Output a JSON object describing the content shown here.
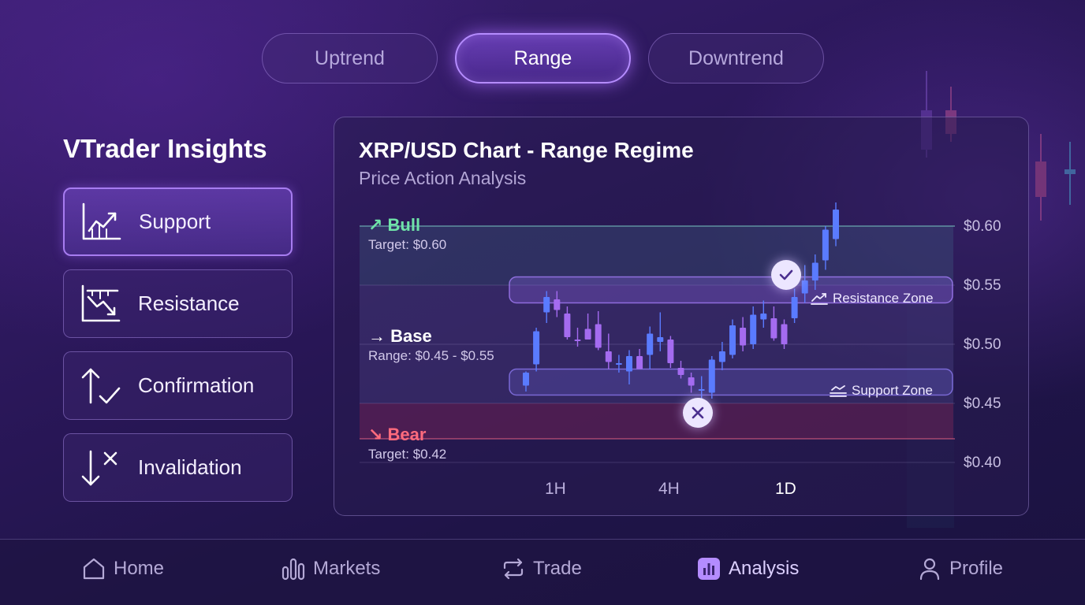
{
  "tabs": [
    {
      "label": "Uptrend",
      "active": false
    },
    {
      "label": "Range",
      "active": true
    },
    {
      "label": "Downtrend",
      "active": false
    }
  ],
  "sidebar": {
    "title": "VTrader Insights",
    "items": [
      {
        "label": "Support",
        "icon": "support-chart-icon",
        "active": true
      },
      {
        "label": "Resistance",
        "icon": "resistance-chart-icon",
        "active": false
      },
      {
        "label": "Confirmation",
        "icon": "confirmation-arrows-icon",
        "active": false
      },
      {
        "label": "Invalidation",
        "icon": "invalidation-arrow-icon",
        "active": false
      }
    ]
  },
  "chart": {
    "title": "XRP/USD Chart - Range Regime",
    "subtitle": "Price Action Analysis",
    "bull_label": "↗ Bull",
    "bull_target": "Target: $0.60",
    "base_label": "→ Base",
    "base_range": "Range: $0.45 - $0.55",
    "bear_label": "↘ Bear",
    "bear_target": "Target: $0.42",
    "resistance_zone": "Resistance Zone",
    "support_zone": "Support Zone",
    "price_ticks": [
      "$0.60",
      "$0.55",
      "$0.50",
      "$0.45",
      "$0.40"
    ],
    "timeframes": [
      {
        "label": "1H",
        "active": false
      },
      {
        "label": "4H",
        "active": false
      },
      {
        "label": "1D",
        "active": true
      }
    ],
    "colors": {
      "bull": "#6fe3a8",
      "bear": "#ff6b7d",
      "accent": "#a77cf0"
    }
  },
  "chart_data": {
    "type": "candlestick",
    "title": "XRP/USD Chart - Range Regime",
    "subtitle": "Price Action Analysis",
    "ylim": [
      0.4,
      0.6
    ],
    "y_ticks": [
      0.6,
      0.55,
      0.5,
      0.45,
      0.4
    ],
    "x_ticks": [
      "1H",
      "4H",
      "1D"
    ],
    "zones": {
      "bull_target": 0.6,
      "resistance": [
        0.535,
        0.557
      ],
      "support": [
        0.457,
        0.479
      ],
      "bear_target": 0.42
    },
    "candles": [
      {
        "o": 0.465,
        "h": 0.477,
        "l": 0.46,
        "c": 0.476
      },
      {
        "o": 0.483,
        "h": 0.514,
        "l": 0.477,
        "c": 0.511
      },
      {
        "o": 0.527,
        "h": 0.545,
        "l": 0.518,
        "c": 0.54
      },
      {
        "o": 0.538,
        "h": 0.545,
        "l": 0.523,
        "c": 0.529
      },
      {
        "o": 0.526,
        "h": 0.532,
        "l": 0.504,
        "c": 0.506
      },
      {
        "o": 0.504,
        "h": 0.514,
        "l": 0.498,
        "c": 0.503
      },
      {
        "o": 0.513,
        "h": 0.526,
        "l": 0.504,
        "c": 0.504
      },
      {
        "o": 0.517,
        "h": 0.528,
        "l": 0.495,
        "c": 0.497
      },
      {
        "o": 0.494,
        "h": 0.509,
        "l": 0.479,
        "c": 0.485
      },
      {
        "o": 0.484,
        "h": 0.491,
        "l": 0.476,
        "c": 0.484
      },
      {
        "o": 0.477,
        "h": 0.495,
        "l": 0.466,
        "c": 0.49
      },
      {
        "o": 0.49,
        "h": 0.496,
        "l": 0.479,
        "c": 0.479
      },
      {
        "o": 0.491,
        "h": 0.515,
        "l": 0.479,
        "c": 0.509
      },
      {
        "o": 0.502,
        "h": 0.527,
        "l": 0.494,
        "c": 0.506
      },
      {
        "o": 0.504,
        "h": 0.507,
        "l": 0.48,
        "c": 0.484
      },
      {
        "o": 0.48,
        "h": 0.486,
        "l": 0.471,
        "c": 0.474
      },
      {
        "o": 0.472,
        "h": 0.476,
        "l": 0.459,
        "c": 0.465
      },
      {
        "o": 0.462,
        "h": 0.473,
        "l": 0.451,
        "c": 0.462
      },
      {
        "o": 0.459,
        "h": 0.49,
        "l": 0.454,
        "c": 0.487
      },
      {
        "o": 0.485,
        "h": 0.502,
        "l": 0.478,
        "c": 0.494
      },
      {
        "o": 0.491,
        "h": 0.521,
        "l": 0.488,
        "c": 0.516
      },
      {
        "o": 0.514,
        "h": 0.523,
        "l": 0.494,
        "c": 0.499
      },
      {
        "o": 0.5,
        "h": 0.532,
        "l": 0.496,
        "c": 0.525
      },
      {
        "o": 0.521,
        "h": 0.537,
        "l": 0.514,
        "c": 0.526
      },
      {
        "o": 0.522,
        "h": 0.532,
        "l": 0.503,
        "c": 0.505
      },
      {
        "o": 0.517,
        "h": 0.521,
        "l": 0.496,
        "c": 0.5
      },
      {
        "o": 0.522,
        "h": 0.547,
        "l": 0.518,
        "c": 0.54
      },
      {
        "o": 0.543,
        "h": 0.567,
        "l": 0.535,
        "c": 0.554
      },
      {
        "o": 0.554,
        "h": 0.576,
        "l": 0.546,
        "c": 0.569
      },
      {
        "o": 0.571,
        "h": 0.6,
        "l": 0.563,
        "c": 0.597
      },
      {
        "o": 0.589,
        "h": 0.62,
        "l": 0.583,
        "c": 0.614
      }
    ],
    "markers": [
      {
        "type": "confirmation",
        "value": 0.559
      },
      {
        "type": "invalidation",
        "value": 0.443
      }
    ]
  },
  "nav": {
    "items": [
      {
        "label": "Home",
        "icon": "home-icon",
        "active": false
      },
      {
        "label": "Markets",
        "icon": "markets-bars-icon",
        "active": false
      },
      {
        "label": "Trade",
        "icon": "trade-swap-icon",
        "active": false
      },
      {
        "label": "Analysis",
        "icon": "analysis-chart-icon",
        "active": true
      },
      {
        "label": "Profile",
        "icon": "profile-icon",
        "active": false
      }
    ]
  }
}
